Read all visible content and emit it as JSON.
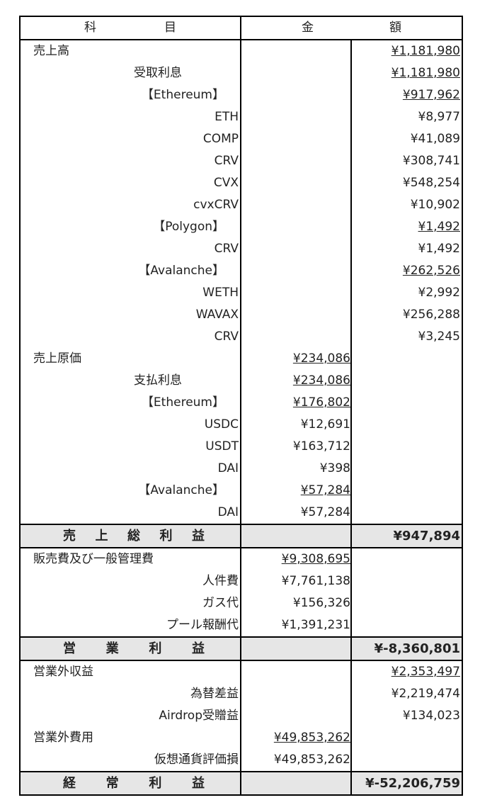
{
  "header": {
    "col1_a": "科",
    "col1_b": "目",
    "col2_a": "金",
    "col2_b": "額"
  },
  "rows": [
    {
      "label": "売上高",
      "indent": 0,
      "amount_col": 3,
      "amount": "¥1,181,980",
      "underline": true
    },
    {
      "label": "受取利息",
      "indent": 1,
      "amount_col": 3,
      "amount": "¥1,181,980",
      "underline": true
    },
    {
      "label": "【Ethereum】",
      "indent": 2,
      "amount_col": 3,
      "amount": "¥917,962",
      "underline": true
    },
    {
      "label": "ETH",
      "indent": 3,
      "amount_col": 3,
      "amount": "¥8,977"
    },
    {
      "label": "COMP",
      "indent": 3,
      "amount_col": 3,
      "amount": "¥41,089"
    },
    {
      "label": "CRV",
      "indent": 3,
      "amount_col": 3,
      "amount": "¥308,741"
    },
    {
      "label": "CVX",
      "indent": 3,
      "amount_col": 3,
      "amount": "¥548,254"
    },
    {
      "label": "cvxCRV",
      "indent": 3,
      "amount_col": 3,
      "amount": "¥10,902"
    },
    {
      "label": "【Polygon】",
      "indent": 2,
      "amount_col": 3,
      "amount": "¥1,492",
      "underline": true
    },
    {
      "label": "CRV",
      "indent": 3,
      "amount_col": 3,
      "amount": "¥1,492"
    },
    {
      "label": "【Avalanche】",
      "indent": 2,
      "amount_col": 3,
      "amount": "¥262,526",
      "underline": true
    },
    {
      "label": "WETH",
      "indent": 3,
      "amount_col": 3,
      "amount": "¥2,992"
    },
    {
      "label": "WAVAX",
      "indent": 3,
      "amount_col": 3,
      "amount": "¥256,288"
    },
    {
      "label": "CRV",
      "indent": 3,
      "amount_col": 3,
      "amount": "¥3,245"
    },
    {
      "label": "売上原価",
      "indent": 0,
      "amount_col": 2,
      "amount": "¥234,086",
      "underline": true
    },
    {
      "label": "支払利息",
      "indent": 1,
      "amount_col": 2,
      "amount": "¥234,086",
      "underline": true
    },
    {
      "label": "【Ethereum】",
      "indent": 2,
      "amount_col": 2,
      "amount": "¥176,802",
      "underline": true
    },
    {
      "label": "USDC",
      "indent": 3,
      "amount_col": 2,
      "amount": "¥12,691"
    },
    {
      "label": "USDT",
      "indent": 3,
      "amount_col": 2,
      "amount": "¥163,712"
    },
    {
      "label": "DAI",
      "indent": 3,
      "amount_col": 2,
      "amount": "¥398"
    },
    {
      "label": "【Avalanche】",
      "indent": 2,
      "amount_col": 2,
      "amount": "¥57,284",
      "underline": true
    },
    {
      "label": "DAI",
      "indent": 3,
      "amount_col": 2,
      "amount": "¥57,284"
    }
  ],
  "gross_profit": {
    "chars": [
      "売",
      "上",
      "総",
      "利",
      "益"
    ],
    "amount": "¥947,894"
  },
  "sga_rows": [
    {
      "label": "販売費及び一般管理費",
      "indent": 0,
      "amount_col": 2,
      "amount": "¥9,308,695",
      "underline": true
    },
    {
      "label": "人件費",
      "indent": 3,
      "amount_col": 2,
      "amount": "¥7,761,138"
    },
    {
      "label": "ガス代",
      "indent": 3,
      "amount_col": 2,
      "amount": "¥156,326"
    },
    {
      "label": "プール報酬代",
      "indent": 3,
      "amount_col": 2,
      "amount": "¥1,391,231"
    }
  ],
  "operating_profit": {
    "chars": [
      "営",
      "業",
      "利",
      "益"
    ],
    "amount": "¥-8,360,801"
  },
  "nonop_rows": [
    {
      "label": "営業外収益",
      "indent": 0,
      "amount_col": 3,
      "amount": "¥2,353,497",
      "underline": true
    },
    {
      "label": "為替差益",
      "indent": 3,
      "amount_col": 3,
      "amount": "¥2,219,474"
    },
    {
      "label": "Airdrop受贈益",
      "indent": 3,
      "amount_col": 3,
      "amount": "¥134,023"
    },
    {
      "label": "営業外費用",
      "indent": 0,
      "amount_col": 2,
      "amount": "¥49,853,262",
      "underline": true
    },
    {
      "label": "仮想通貨評価損",
      "indent": 3,
      "amount_col": 2,
      "amount": "¥49,853,262"
    }
  ],
  "ordinary_profit": {
    "chars": [
      "経",
      "常",
      "利",
      "益"
    ],
    "amount": "¥-52,206,759"
  }
}
